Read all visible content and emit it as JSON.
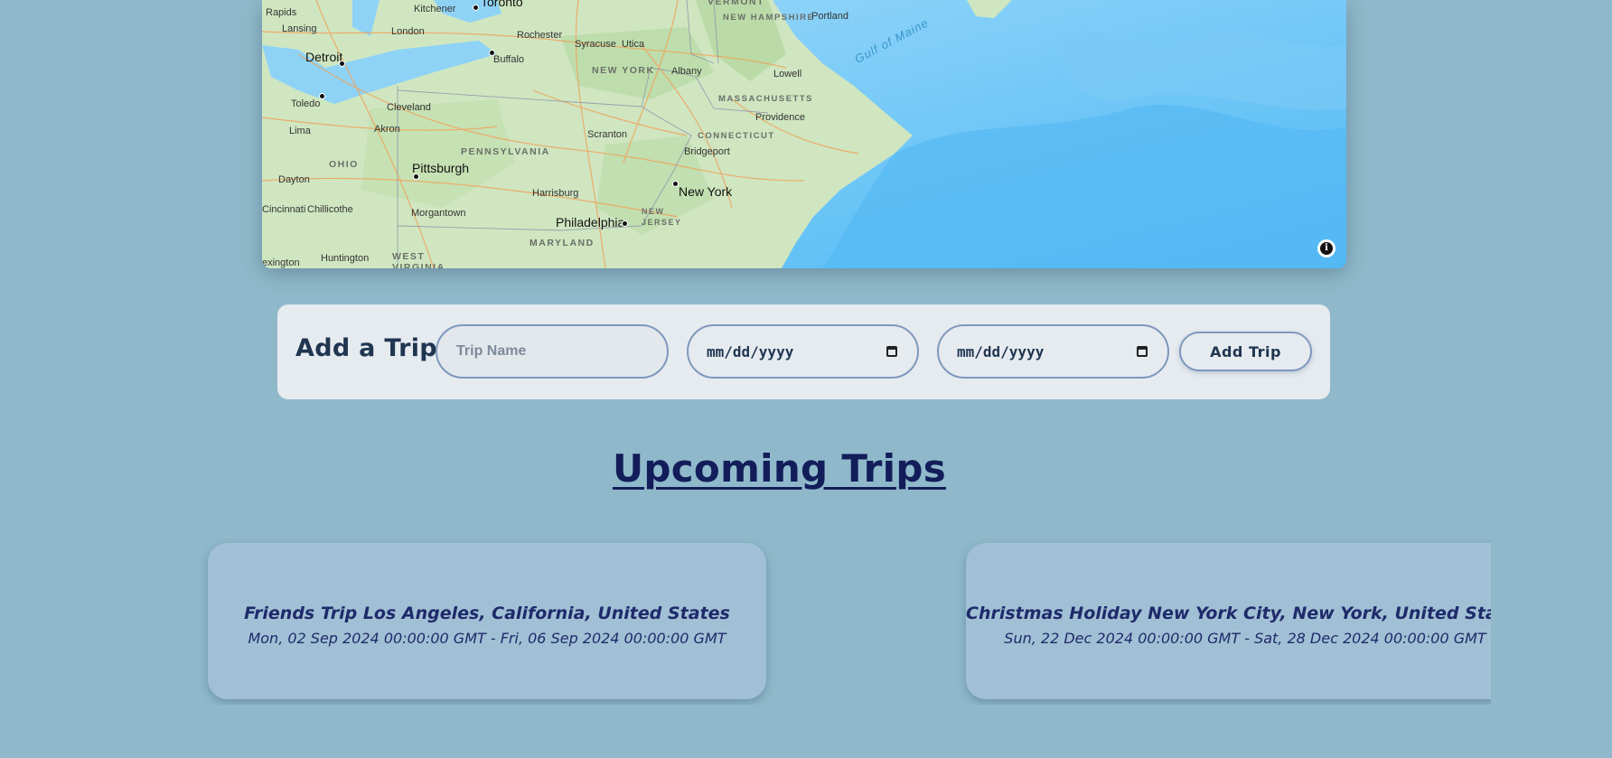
{
  "map": {
    "cities": [
      "Rapids",
      "Kitchener",
      "Toronto",
      "Lansing",
      "London",
      "Rochester",
      "Syracuse",
      "Utica",
      "Portland",
      "Detroit",
      "Buffalo",
      "Albany",
      "Lowell",
      "Toledo",
      "Cleveland",
      "Providence",
      "Lima",
      "Akron",
      "Scranton",
      "Bridgeport",
      "Pittsburgh",
      "New York",
      "Dayton",
      "Harrisburg",
      "Cincinnati",
      "Chillicothe",
      "Morgantown",
      "Philadelphia",
      "Huntington",
      "exington"
    ],
    "states": [
      "VERMONT",
      "NEW HAMPSHIRE",
      "NEW YORK",
      "MASSACHUSETTS",
      "CONNECTICUT",
      "PENNSYLVANIA",
      "OHIO",
      "NEW JERSEY",
      "MARYLAND",
      "WEST VIRGINIA"
    ],
    "water_label": "Gulf of Maine",
    "info_icon": "info-icon"
  },
  "add_trip": {
    "title": "Add a Trip",
    "name_placeholder": "Trip Name",
    "start_date_placeholder": "mm/dd/yyyy",
    "end_date_placeholder": "mm/dd/yyyy",
    "submit_label": "Add Trip"
  },
  "upcoming": {
    "title": "Upcoming Trips",
    "trips": [
      {
        "name": "Friends Trip Los Angeles, California, United States",
        "dates": "Mon, 02 Sep 2024 00:00:00 GMT - Fri, 06 Sep 2024 00:00:00 GMT"
      },
      {
        "name": "Christmas Holiday New York City, New York, United States",
        "dates": "Sun, 22 Dec 2024 00:00:00 GMT - Sat, 28 Dec 2024 00:00:00 GMT"
      }
    ]
  },
  "colors": {
    "page_background": "#8fb9ca",
    "form_background": "#e6ebf0",
    "card_background": "#a1c0d5",
    "title_color": "#121d5a",
    "text_dark": "#1f3550",
    "ocean": "#5cc0f6",
    "land": "#cfe6c1"
  }
}
